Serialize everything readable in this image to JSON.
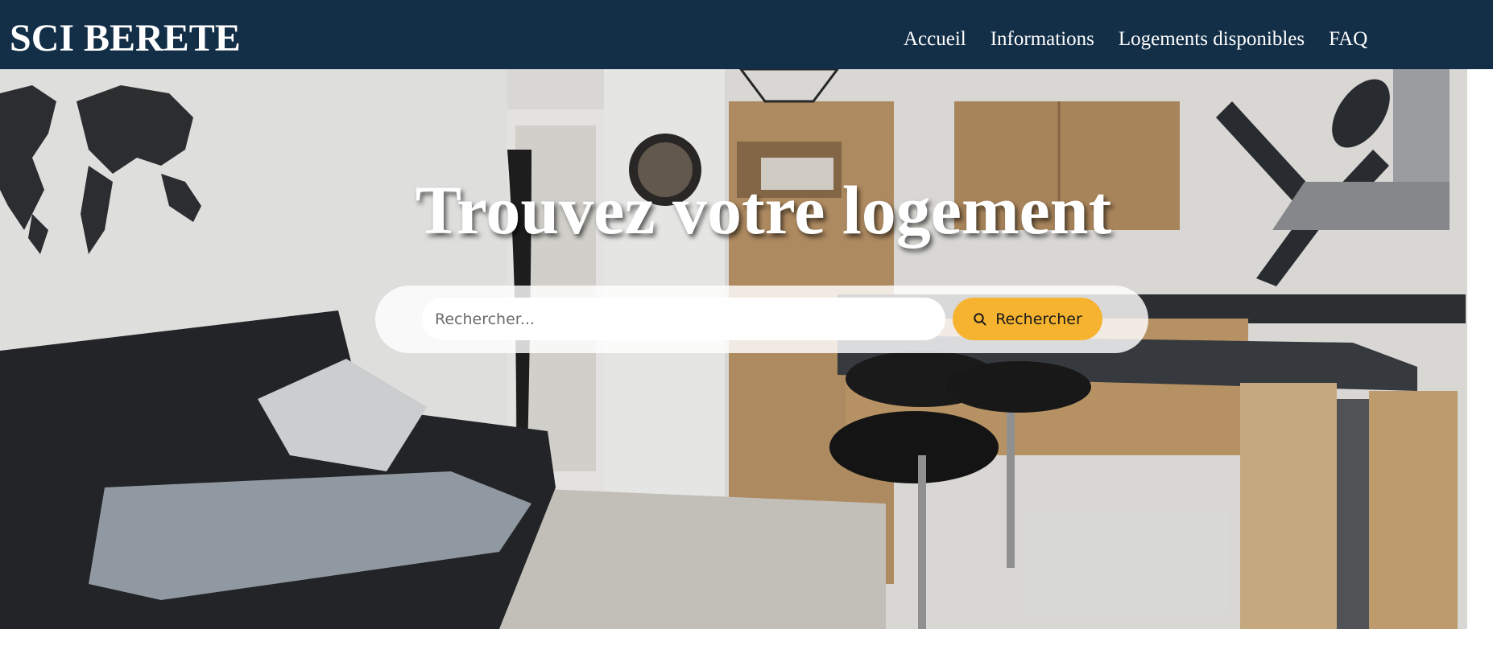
{
  "header": {
    "brand": "SCI BERETE",
    "nav": [
      "Accueil",
      "Informations",
      "Logements disponibles",
      "FAQ"
    ]
  },
  "hero": {
    "title": "Trouvez votre logement",
    "search": {
      "placeholder": "Rechercher...",
      "value": "",
      "button_label": "Rechercher",
      "button_icon": "search-icon"
    }
  },
  "colors": {
    "header_bg": "#132e47",
    "accent": "#f6b330"
  }
}
